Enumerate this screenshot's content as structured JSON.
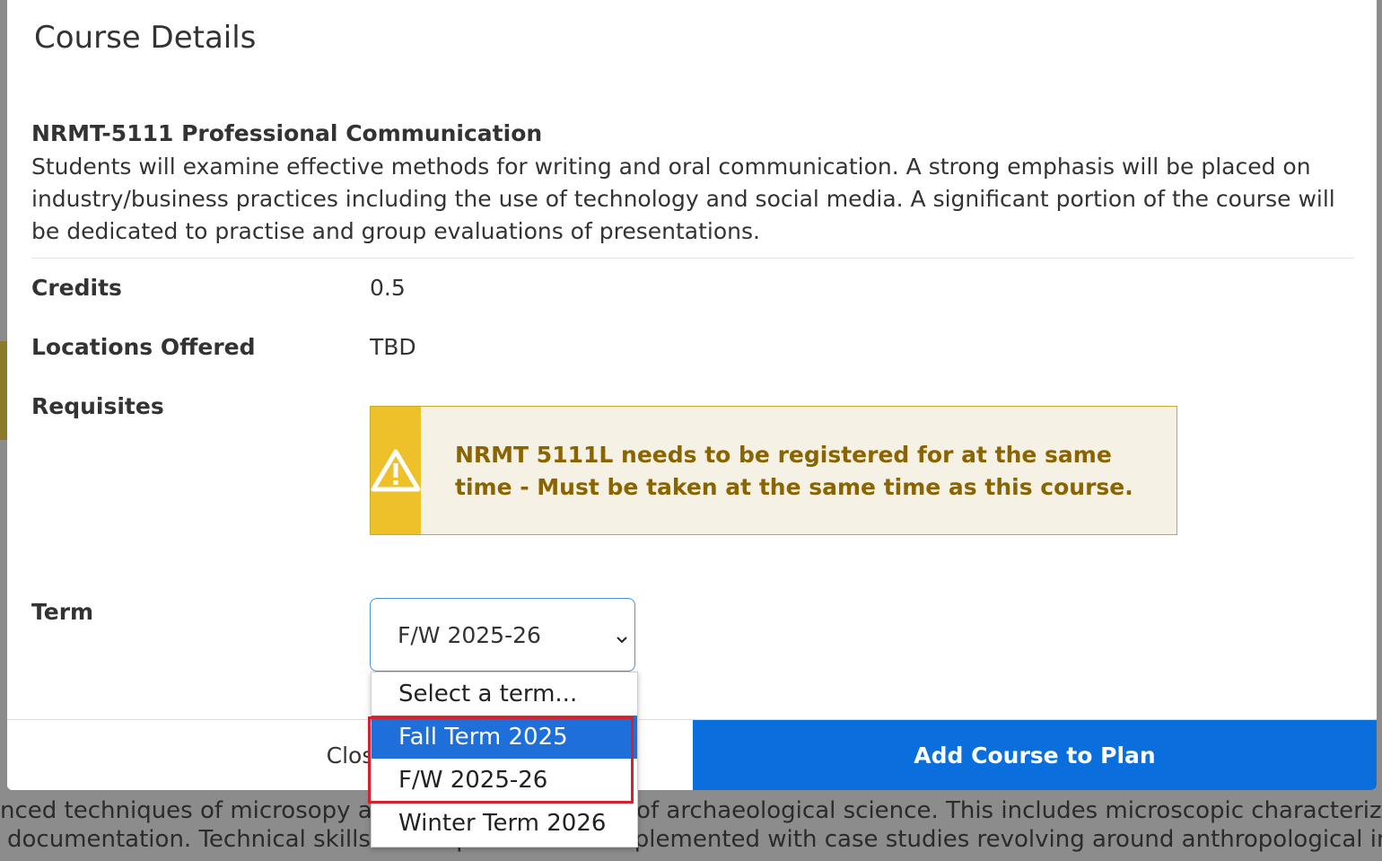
{
  "modal": {
    "title": "Course Details",
    "course_title": "NRMT-5111 Professional Communication",
    "description": "Students will examine effective methods for writing and oral communication. A strong emphasis will be placed on industry/business practices including the use of technology and social media. A significant portion of the course will be dedicated to practise and group evaluations of presentations.",
    "credits_label": "Credits",
    "credits_value": "0.5",
    "locations_label": "Locations Offered",
    "locations_value": "TBD",
    "requisites_label": "Requisites",
    "requisite_message": "NRMT 5111L needs to be registered for at the same time - Must be taken at the same time as this course.",
    "term_label": "Term",
    "term_selected": "F/W 2025-26",
    "term_options": [
      "Select a term...",
      "Fall Term 2025",
      "F/W 2025-26",
      "Winter Term 2026"
    ],
    "highlighted_option": "Fall Term 2025",
    "close_label": "Clos",
    "add_label": "Add Course to Plan"
  },
  "background": {
    "line1": "nced techniques of microsopy are used in the context of archaeological science. This includes microscopic characteriza",
    "line2": "documentation. Technical skills development are complemented with case studies revolving around anthropological interpret"
  },
  "colors": {
    "primary": "#0a6fdc",
    "warning_bg": "#f5f1e4",
    "warning_icon_bg": "#eec12b",
    "warning_text": "#8a6400",
    "highlight": "#d0222f"
  }
}
